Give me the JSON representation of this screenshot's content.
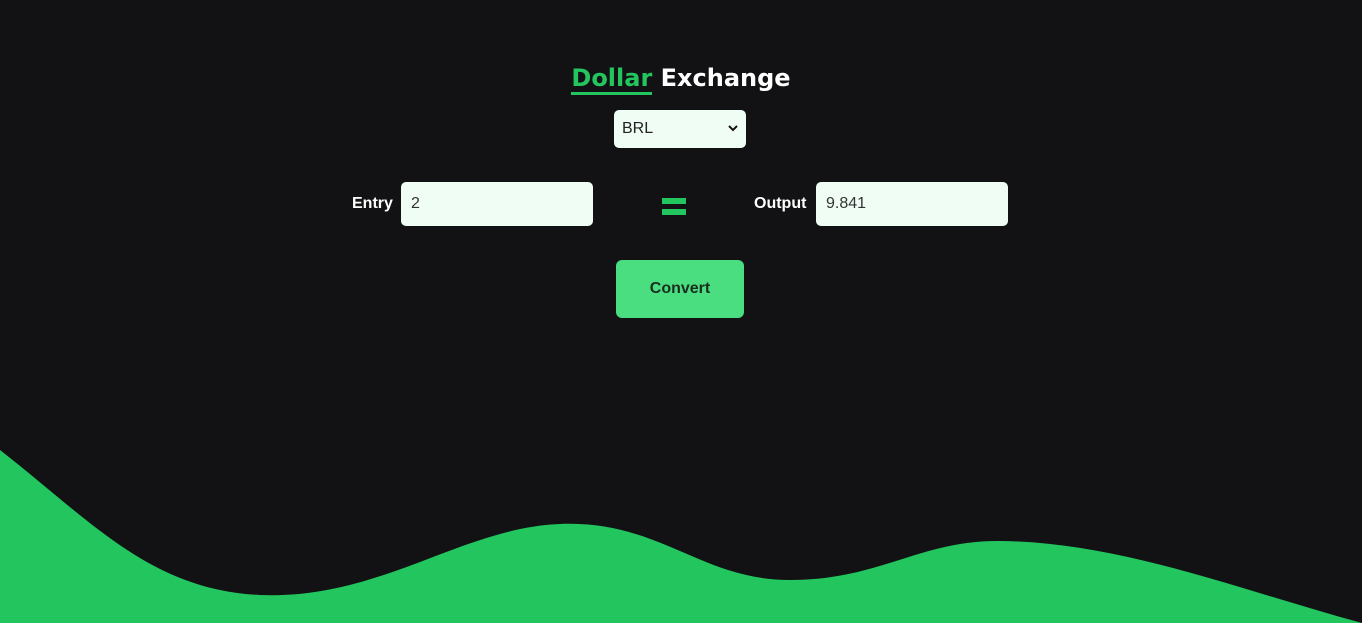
{
  "title": {
    "accent_word": "Dollar",
    "rest": "Exchange"
  },
  "currency_select": {
    "selected": "BRL",
    "icon": "chevron-down-icon"
  },
  "entry": {
    "label": "Entry",
    "value": "2"
  },
  "equals_icon": "equals-icon",
  "output": {
    "label": "Output",
    "value": "9.841"
  },
  "convert_button": {
    "label": "Convert"
  },
  "colors": {
    "background": "#121214",
    "accent": "#22c55e",
    "button": "#4ade80",
    "input_bg": "#f0fdf4"
  }
}
